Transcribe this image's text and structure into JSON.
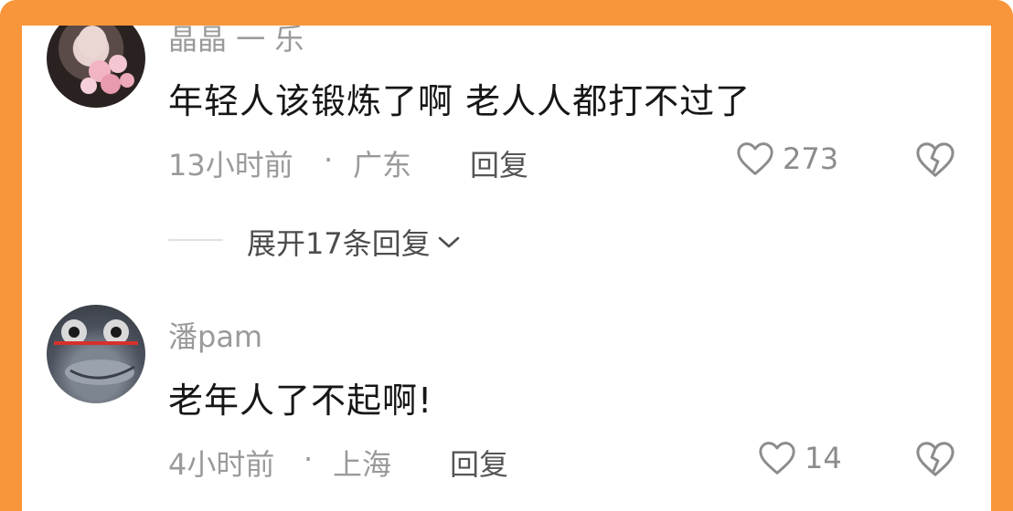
{
  "comments": [
    {
      "username": "晶晶 一 乐",
      "text": "年轻人该锻炼了啊 老人人都打不过了",
      "time": "13小时前",
      "dot": "·",
      "location": "广东",
      "reply_label": "回复",
      "likes": "273",
      "expand_label": "展开17条回复"
    },
    {
      "username": "潘pam",
      "text": "老年人了不起啊!",
      "time": "4小时前",
      "dot": "·",
      "location": "上海",
      "reply_label": "回复",
      "likes": "14"
    }
  ],
  "colors": {
    "frame": "#f9963b",
    "meta": "#9a9a9a"
  },
  "icons": [
    "heart-icon",
    "broken-heart-icon",
    "chevron-down-icon"
  ]
}
